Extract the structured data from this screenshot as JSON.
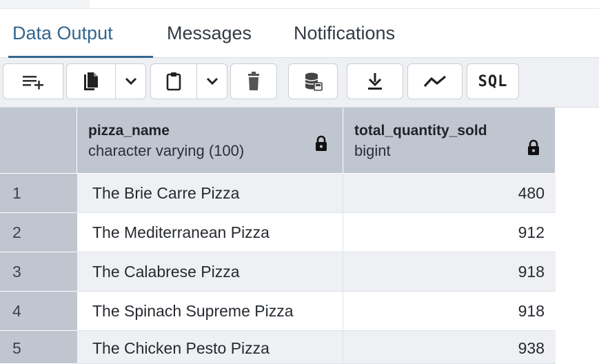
{
  "tabs": [
    {
      "label": "Data Output",
      "active": true
    },
    {
      "label": "Messages",
      "active": false
    },
    {
      "label": "Notifications",
      "active": false
    }
  ],
  "toolbar": {
    "buttons": [
      {
        "icon": "add-row-icon"
      },
      {
        "icon": "copy-icon"
      },
      {
        "icon": "chevron-down-icon"
      },
      {
        "icon": "paste-icon"
      },
      {
        "icon": "chevron-down-icon"
      },
      {
        "icon": "delete-icon"
      },
      {
        "icon": "save-data-icon"
      },
      {
        "icon": "download-icon"
      },
      {
        "icon": "graph-icon"
      },
      {
        "icon": "sql-icon",
        "label": "SQL"
      }
    ]
  },
  "table": {
    "columns": [
      {
        "name": "pizza_name",
        "type": "character varying (100)",
        "locked": true
      },
      {
        "name": "total_quantity_sold",
        "type": "bigint",
        "locked": true
      }
    ],
    "rows": [
      {
        "num": "1",
        "pizza_name": "The Brie Carre Pizza",
        "total_quantity_sold": "480"
      },
      {
        "num": "2",
        "pizza_name": "The Mediterranean Pizza",
        "total_quantity_sold": "912"
      },
      {
        "num": "3",
        "pizza_name": "The Calabrese Pizza",
        "total_quantity_sold": "918"
      },
      {
        "num": "4",
        "pizza_name": "The Spinach Supreme Pizza",
        "total_quantity_sold": "918"
      },
      {
        "num": "5",
        "pizza_name": "The Chicken Pesto Pizza",
        "total_quantity_sold": "938"
      }
    ]
  },
  "colors": {
    "accent": "#326690",
    "header_bg": "#bfc6d0",
    "toolbar_bg": "#eef0f3",
    "alt_row_bg": "#eef0f3"
  }
}
